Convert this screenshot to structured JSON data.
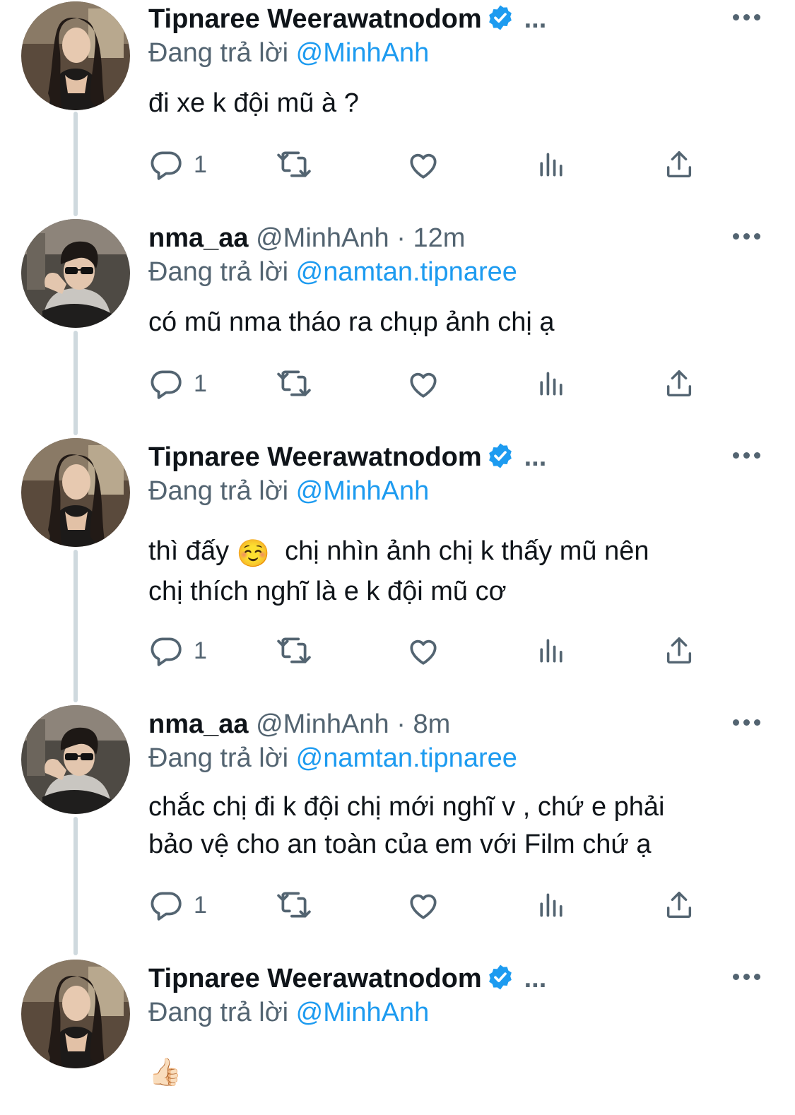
{
  "tweets": [
    {
      "author_name": "Tipnaree Weerawatnodom",
      "verified": true,
      "handle": "",
      "time": "",
      "trunc": "...",
      "replying_prefix": "Đang trả lời",
      "replying_to": "@MinhAnh",
      "text": "đi xe k đội mũ à ?",
      "reply_count": "1",
      "avatar": "avatar-tipnaree"
    },
    {
      "author_name": "nma_aa",
      "verified": false,
      "handle": "@MinhAnh",
      "dot": "·",
      "time": "12m",
      "replying_prefix": "Đang trả lời",
      "replying_to": "@namtan.tipnaree",
      "text": "có mũ nma tháo ra chụp ảnh chị ạ",
      "reply_count": "1",
      "avatar": "avatar-minhanh"
    },
    {
      "author_name": "Tipnaree Weerawatnodom",
      "verified": true,
      "trunc": "...",
      "replying_prefix": "Đang trả lời",
      "replying_to": "@MinhAnh",
      "text_line1_a": "thì đấy",
      "text_emoji": "☺️",
      "text_line1_b": "chị nhìn ảnh chị k thấy mũ nên",
      "text_line2": "chị thích nghĩ là e k đội mũ cơ",
      "reply_count": "1",
      "avatar": "avatar-tipnaree"
    },
    {
      "author_name": "nma_aa",
      "verified": false,
      "handle": "@MinhAnh",
      "dot": "·",
      "time": "8m",
      "replying_prefix": "Đang trả lời",
      "replying_to": "@namtan.tipnaree",
      "text_line1": "chắc chị đi k đội chị mới nghĩ v , chứ e phải",
      "text_line2": "bảo vệ cho an toàn của em với Film chứ ạ",
      "reply_count": "1",
      "avatar": "avatar-minhanh"
    },
    {
      "author_name": "Tipnaree Weerawatnodom",
      "verified": true,
      "trunc": "...",
      "replying_prefix": "Đang trả lời",
      "replying_to": "@MinhAnh",
      "text": "👍🏻",
      "avatar": "avatar-tipnaree"
    }
  ],
  "colors": {
    "text": "#0f1419",
    "secondary": "#536471",
    "link": "#1d9bf0",
    "thread_line": "#cfd9de",
    "verified": "#1d9bf0"
  },
  "icons": [
    "reply-icon",
    "retweet-icon",
    "like-icon",
    "views-icon",
    "share-icon",
    "more-icon",
    "verified-badge-icon"
  ]
}
